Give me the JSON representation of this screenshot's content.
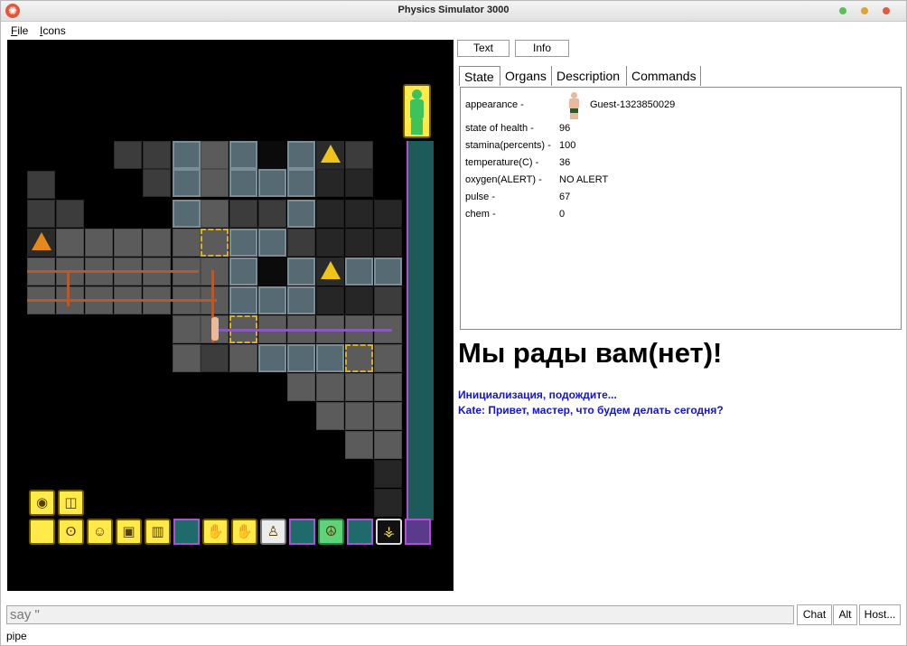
{
  "window": {
    "title": "Physics Simulator 3000",
    "buttons": [
      {
        "name": "green",
        "color": "#57c057"
      },
      {
        "name": "yellow",
        "color": "#e0a52e"
      },
      {
        "name": "red",
        "color": "#e05b3b"
      }
    ]
  },
  "menu": {
    "file": {
      "underline": "F",
      "rest": "ile"
    },
    "icons": {
      "underline": "I",
      "rest": "cons"
    }
  },
  "view_buttons": {
    "text": "Text",
    "info": "Info"
  },
  "tabs": [
    "State",
    "Organs",
    "Description",
    "Commands"
  ],
  "state": {
    "appearance_label": "appearance -",
    "appearance_value": "Guest-1323850029",
    "rows": [
      {
        "label": "state of health -",
        "value": "96"
      },
      {
        "label": "stamina(percents) -",
        "value": "100"
      },
      {
        "label": "temperature(C) -",
        "value": "36"
      },
      {
        "label": "oxygen(ALERT) -",
        "value": "NO ALERT"
      },
      {
        "label": "pulse -",
        "value": "67"
      },
      {
        "label": "chem -",
        "value": "0"
      }
    ]
  },
  "chat": {
    "welcome": "Мы рады вам(нет)!",
    "messages": [
      "Инициализация, подождите...",
      "Kate: Привет, мастер, что будем делать сегодня?"
    ]
  },
  "input": {
    "value": "say \""
  },
  "bottom_buttons": {
    "chat": "Chat",
    "alt": "Alt",
    "host": "Host..."
  },
  "status": "pipe",
  "colors": {
    "hud_yellow": "#ffea4a",
    "chat_blue": "#1414c8",
    "viewport_bg": "#000000",
    "rail_teal": "#1d5a5a"
  }
}
